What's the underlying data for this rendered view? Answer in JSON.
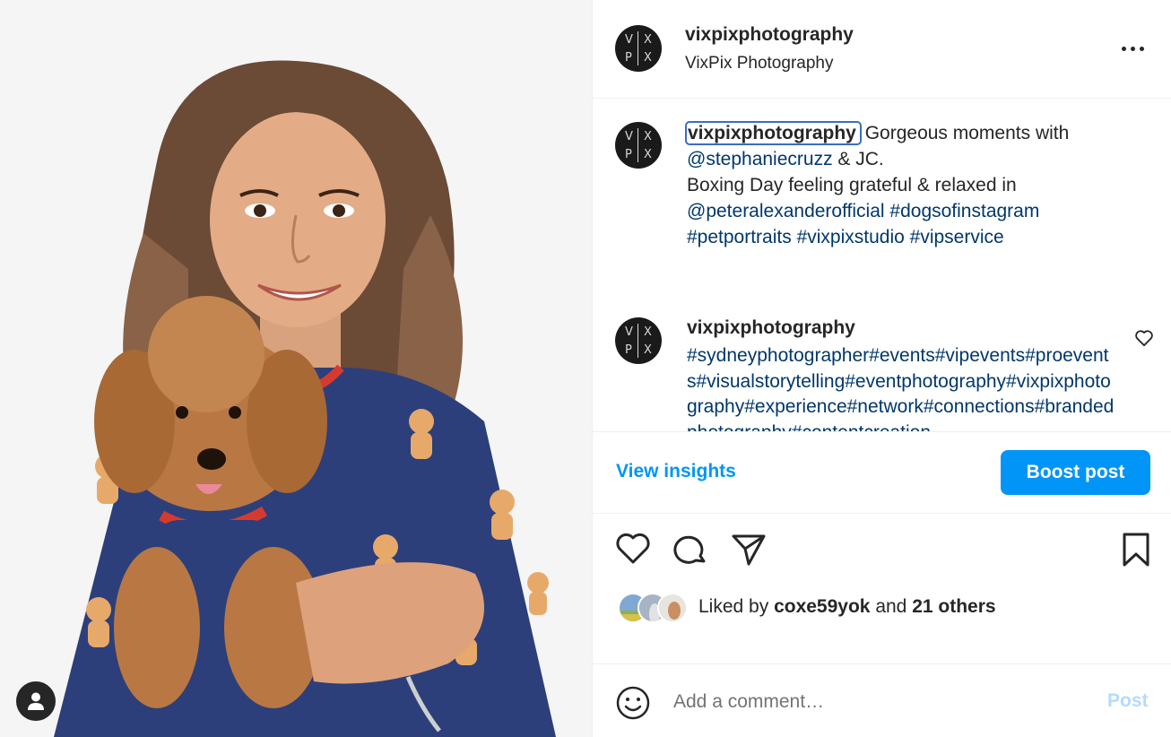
{
  "post": {
    "username": "vixpixphotography",
    "location": "VixPix Photography",
    "avatar_letters": [
      "V",
      "X",
      "P",
      "X"
    ]
  },
  "caption": {
    "username": "vixpixphotography",
    "line1_text": "Gorgeous moments with",
    "mention1": "@stephaniecruzz",
    "line2_text": " & JC.",
    "line3_text": "Boxing Day feeling grateful & relaxed in",
    "mention2": "@peteralexanderofficial",
    "tag1": "#dogsofinstagram",
    "tag2": "#petportraits",
    "tag3": "#vixpixstudio",
    "tag4": "#vipservice"
  },
  "comment": {
    "username": "vixpixphotography",
    "text": "#sydneyphotographer#events#vipevents#proevents#visualstorytelling#eventphotography#vixpixphotography#experience#network#connections#brandedphotography#contentcreation"
  },
  "insights": {
    "view_label": "View insights",
    "boost_label": "Boost post"
  },
  "likes": {
    "prefix": "Liked by ",
    "user": "coxe59yok",
    "middle": " and ",
    "others": "21 others"
  },
  "comment_box": {
    "placeholder": "Add a comment…",
    "post_label": "Post"
  },
  "colors": {
    "accent": "#0095f6",
    "link": "#00376b",
    "text": "#262626",
    "post_disabled": "#b3dbff"
  },
  "icons": [
    "more-icon",
    "heart-icon",
    "comment-icon",
    "share-icon",
    "bookmark-icon",
    "emoji-icon",
    "user-tag-icon"
  ]
}
